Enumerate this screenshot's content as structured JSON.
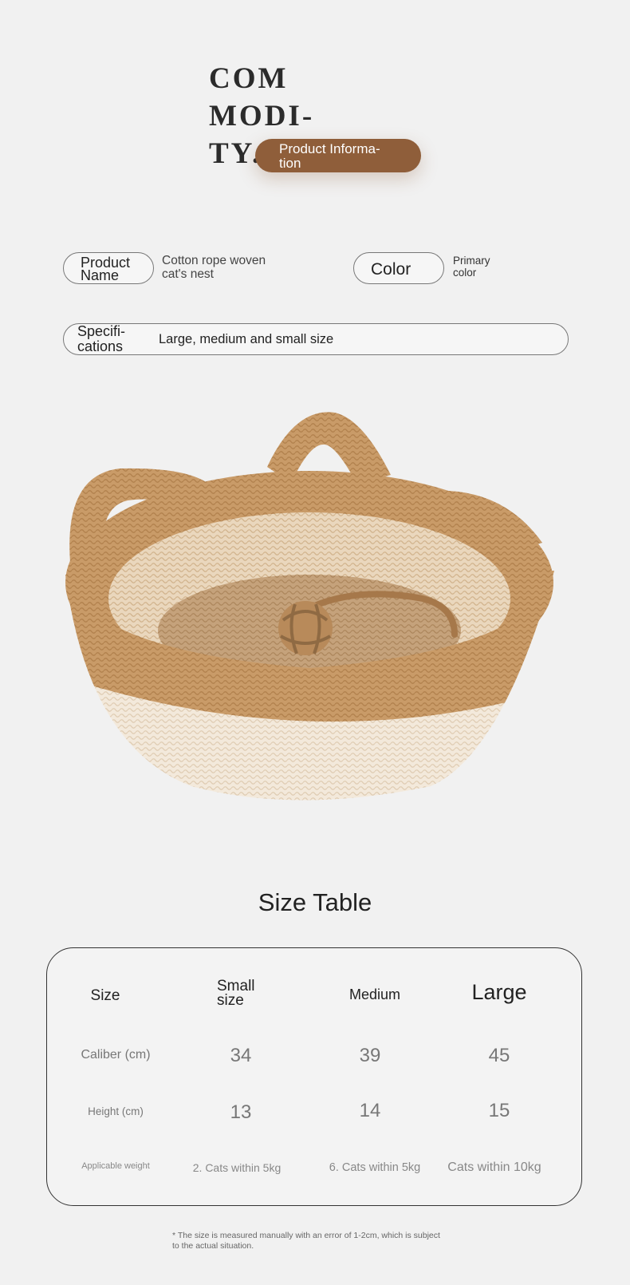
{
  "header": {
    "title_lines": [
      "COM",
      "MODI-",
      "TY."
    ],
    "badge_lines": [
      "Product Informa-",
      "tion"
    ]
  },
  "info": {
    "product_name_label_lines": [
      "Product",
      "Name"
    ],
    "product_name_value_lines": [
      "Cotton rope woven",
      "cat's nest"
    ],
    "color_label": "Color",
    "color_value_lines": [
      "Primary",
      "color"
    ],
    "specifications_label_lines": [
      "Specifi-",
      "cations"
    ],
    "specifications_value": "Large, medium and small size"
  },
  "colors": {
    "accent_brown": "#8f5e3a",
    "basket_tan": "#c99b68",
    "basket_cream": "#f4ebdd",
    "background": "#f1f1f1"
  },
  "size_table": {
    "title": "Size Table",
    "headers": [
      "Size",
      "Small size",
      "Medium",
      "Large"
    ],
    "rows": [
      {
        "label": "Caliber (cm)",
        "values": [
          "34",
          "39",
          "45"
        ]
      },
      {
        "label": "Height (cm)",
        "values": [
          "13",
          "14",
          "15"
        ]
      },
      {
        "label": "Applicable weight",
        "values": [
          "2. Cats within 5kg",
          "6. Cats within 5kg",
          "Cats within 10kg"
        ]
      }
    ]
  },
  "footnote_lines": [
    "* The size is measured manually with an error of 1-2cm, which is subject",
    "to the actual situation."
  ]
}
